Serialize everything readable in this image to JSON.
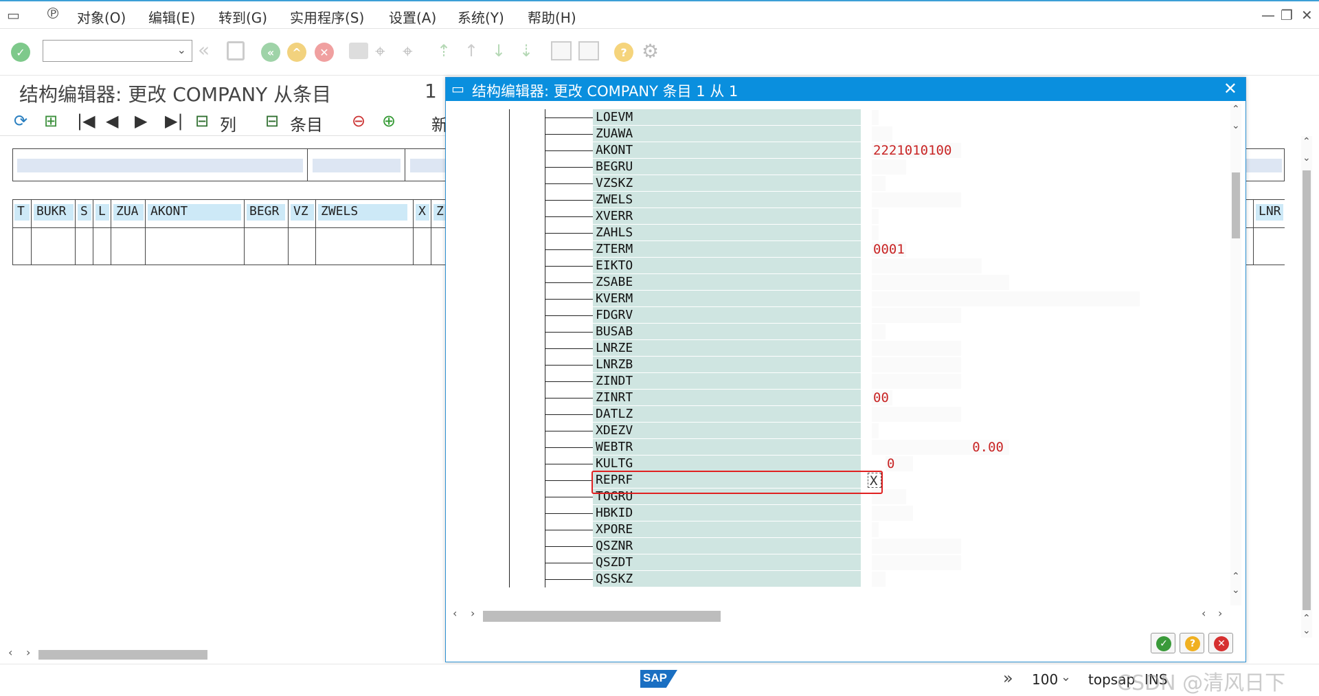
{
  "menu": {
    "items": [
      "对象(O)",
      "编辑(E)",
      "转到(G)",
      "实用程序(S)",
      "设置(A)",
      "系统(Y)",
      "帮助(H)"
    ]
  },
  "page": {
    "title": "结构编辑器: 更改 COMPANY 从条目",
    "number": "1"
  },
  "app_toolbar": {
    "columns_label": "列",
    "entries_label": "条目",
    "new_label": "新"
  },
  "table": {
    "headers": [
      "T",
      "BUKR",
      "S",
      "L",
      "ZUA",
      "AKONT",
      "BEGR",
      "VZ",
      "ZWELS",
      "X",
      "Z"
    ],
    "right_header": "LNR"
  },
  "dialog": {
    "title": "结构编辑器: 更改 COMPANY 条目 1 从 1",
    "close": "✕",
    "fields": [
      {
        "name": "LOEVM",
        "value": ""
      },
      {
        "name": "ZUAWA",
        "value": ""
      },
      {
        "name": "AKONT",
        "value": "2221010100"
      },
      {
        "name": "BEGRU",
        "value": ""
      },
      {
        "name": "VZSKZ",
        "value": ""
      },
      {
        "name": "ZWELS",
        "value": ""
      },
      {
        "name": "XVERR",
        "value": ""
      },
      {
        "name": "ZAHLS",
        "value": ""
      },
      {
        "name": "ZTERM",
        "value": "0001"
      },
      {
        "name": "EIKTO",
        "value": ""
      },
      {
        "name": "ZSABE",
        "value": ""
      },
      {
        "name": "KVERM",
        "value": ""
      },
      {
        "name": "FDGRV",
        "value": ""
      },
      {
        "name": "BUSAB",
        "value": ""
      },
      {
        "name": "LNRZE",
        "value": ""
      },
      {
        "name": "LNRZB",
        "value": ""
      },
      {
        "name": "ZINDT",
        "value": ""
      },
      {
        "name": "ZINRT",
        "value": "00"
      },
      {
        "name": "DATLZ",
        "value": ""
      },
      {
        "name": "XDEZV",
        "value": ""
      },
      {
        "name": "WEBTR",
        "value": "0.00"
      },
      {
        "name": "KULTG",
        "value": "0"
      },
      {
        "name": "REPRF",
        "value": "X"
      },
      {
        "name": "TOGRU",
        "value": ""
      },
      {
        "name": "HBKID",
        "value": ""
      },
      {
        "name": "XPORE",
        "value": ""
      },
      {
        "name": "QSZNR",
        "value": ""
      },
      {
        "name": "QSZDT",
        "value": ""
      },
      {
        "name": "QSSKZ",
        "value": ""
      }
    ]
  },
  "status": {
    "logo": "SAP",
    "zoom": "100",
    "server": "topsap",
    "mode": "INS",
    "watermark": "CSDN @清风日下"
  },
  "icons": {
    "confirm": "check-icon",
    "help": "question-icon",
    "cancel": "cancel-icon"
  },
  "colors": {
    "dialog_title": "#0a8fde",
    "field_name_bg": "#cfe5e1",
    "value_text": "#c82424",
    "header_cell_bg": "#cde9f7",
    "highlight": "#e02020"
  }
}
